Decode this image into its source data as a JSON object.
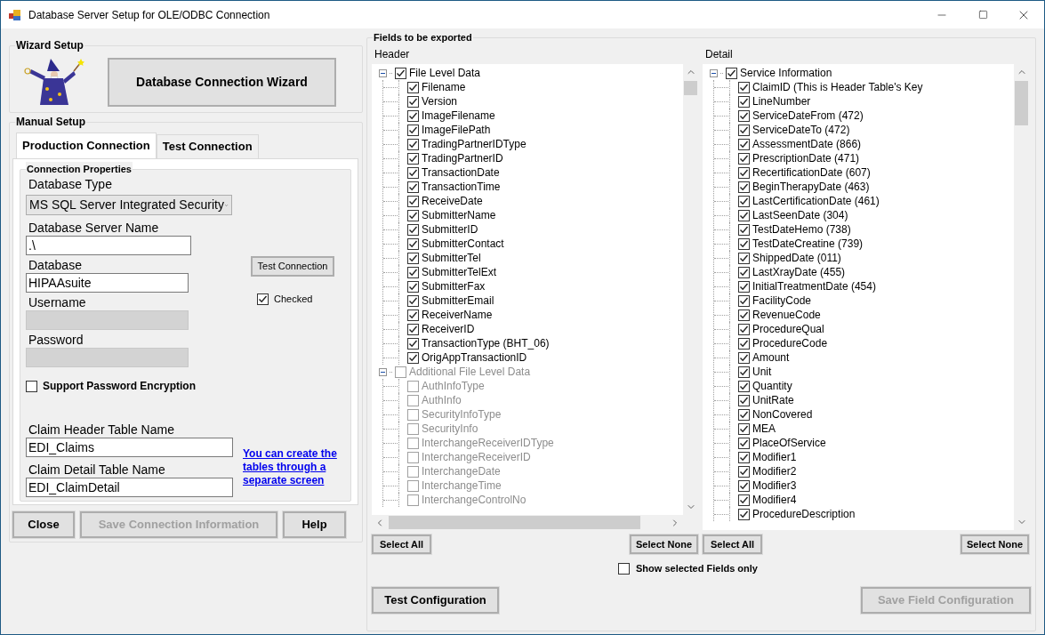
{
  "window": {
    "title": "Database Server Setup for OLE/ODBC Connection"
  },
  "wizard_setup": {
    "title": "Wizard Setup",
    "button": "Database Connection Wizard"
  },
  "manual_setup": {
    "title": "Manual Setup",
    "tabs": [
      {
        "label": "Production Connection",
        "selected": true
      },
      {
        "label": "Test Connection",
        "selected": false
      }
    ],
    "connection_properties": {
      "title": "Connection Properties",
      "database_type": {
        "label": "Database Type",
        "value": "MS SQL Server Integrated Security"
      },
      "server_name": {
        "label": "Database Server Name",
        "value": ".\\"
      },
      "database": {
        "label": "Database",
        "value": "HIPAAsuite"
      },
      "username": {
        "label": "Username",
        "disabled": true
      },
      "password": {
        "label": "Password",
        "disabled": true
      },
      "test_button": "Test Connection",
      "checked_box": {
        "label": "Checked",
        "checked": true
      },
      "encryption": {
        "label": "Support Password Encryption",
        "checked": false
      },
      "header_table": {
        "label": "Claim Header Table Name",
        "value": "EDI_Claims"
      },
      "detail_table": {
        "label": "Claim Detail Table Name",
        "value": "EDI_ClaimDetail"
      },
      "link": "You can create the tables through a separate screen"
    }
  },
  "buttons": [
    {
      "label": "Close",
      "disabled": false
    },
    {
      "label": "Save Connection Information",
      "disabled": true
    },
    {
      "label": "Help",
      "disabled": false
    }
  ],
  "fields": {
    "title": "Fields to be exported",
    "panels": [
      {
        "label": "Header",
        "select_all": "Select All",
        "select_none": "Select None",
        "tree": [
          {
            "label": "File Level Data",
            "checked": true,
            "disabled": false,
            "expanded": true,
            "children": [
              {
                "label": "Filename",
                "checked": true,
                "disabled": false
              },
              {
                "label": "Version",
                "checked": true,
                "disabled": false
              },
              {
                "label": "ImageFilename",
                "checked": true,
                "disabled": false
              },
              {
                "label": "ImageFilePath",
                "checked": true,
                "disabled": false
              },
              {
                "label": "TradingPartnerIDType",
                "checked": true,
                "disabled": false
              },
              {
                "label": "TradingPartnerID",
                "checked": true,
                "disabled": false
              },
              {
                "label": "TransactionDate",
                "checked": true,
                "disabled": false
              },
              {
                "label": "TransactionTime",
                "checked": true,
                "disabled": false
              },
              {
                "label": "ReceiveDate",
                "checked": true,
                "disabled": false
              },
              {
                "label": "SubmitterName",
                "checked": true,
                "disabled": false
              },
              {
                "label": "SubmitterID",
                "checked": true,
                "disabled": false
              },
              {
                "label": "SubmitterContact",
                "checked": true,
                "disabled": false
              },
              {
                "label": "SubmitterTel",
                "checked": true,
                "disabled": false
              },
              {
                "label": "SubmitterTelExt",
                "checked": true,
                "disabled": false
              },
              {
                "label": "SubmitterFax",
                "checked": true,
                "disabled": false
              },
              {
                "label": "SubmitterEmail",
                "checked": true,
                "disabled": false
              },
              {
                "label": "ReceiverName",
                "checked": true,
                "disabled": false
              },
              {
                "label": "ReceiverID",
                "checked": true,
                "disabled": false
              },
              {
                "label": "TransactionType (BHT_06)",
                "checked": true,
                "disabled": false
              },
              {
                "label": "OrigAppTransactionID",
                "checked": true,
                "disabled": false
              }
            ]
          },
          {
            "label": "Additional File Level Data",
            "checked": false,
            "disabled": true,
            "expanded": true,
            "children": [
              {
                "label": "AuthInfoType",
                "checked": false,
                "disabled": true
              },
              {
                "label": "AuthInfo",
                "checked": false,
                "disabled": true
              },
              {
                "label": "SecurityInfoType",
                "checked": false,
                "disabled": true
              },
              {
                "label": "SecurityInfo",
                "checked": false,
                "disabled": true
              },
              {
                "label": "InterchangeReceiverIDType",
                "checked": false,
                "disabled": true
              },
              {
                "label": "InterchangeReceiverID",
                "checked": false,
                "disabled": true
              },
              {
                "label": "InterchangeDate",
                "checked": false,
                "disabled": true
              },
              {
                "label": "InterchangeTime",
                "checked": false,
                "disabled": true
              },
              {
                "label": "InterchangeControlNo",
                "checked": false,
                "disabled": true
              }
            ]
          }
        ]
      },
      {
        "label": "Detail",
        "select_all": "Select All",
        "select_none": "Select None",
        "tree": [
          {
            "label": "Service Information",
            "checked": true,
            "disabled": false,
            "expanded": true,
            "children": [
              {
                "label": "ClaimID (This is Header Table's Key",
                "checked": true,
                "disabled": false
              },
              {
                "label": "LineNumber",
                "checked": true,
                "disabled": false
              },
              {
                "label": "ServiceDateFrom (472)",
                "checked": true,
                "disabled": false
              },
              {
                "label": "ServiceDateTo (472)",
                "checked": true,
                "disabled": false
              },
              {
                "label": "AssessmentDate (866)",
                "checked": true,
                "disabled": false
              },
              {
                "label": "PrescriptionDate (471)",
                "checked": true,
                "disabled": false
              },
              {
                "label": "RecertificationDate (607)",
                "checked": true,
                "disabled": false
              },
              {
                "label": "BeginTherapyDate (463)",
                "checked": true,
                "disabled": false
              },
              {
                "label": "LastCertificationDate (461)",
                "checked": true,
                "disabled": false
              },
              {
                "label": "LastSeenDate (304)",
                "checked": true,
                "disabled": false
              },
              {
                "label": "TestDateHemo (738)",
                "checked": true,
                "disabled": false
              },
              {
                "label": "TestDateCreatine (739)",
                "checked": true,
                "disabled": false
              },
              {
                "label": "ShippedDate (011)",
                "checked": true,
                "disabled": false
              },
              {
                "label": "LastXrayDate (455)",
                "checked": true,
                "disabled": false
              },
              {
                "label": "InitialTreatmentDate (454)",
                "checked": true,
                "disabled": false
              },
              {
                "label": "FacilityCode",
                "checked": true,
                "disabled": false
              },
              {
                "label": "RevenueCode",
                "checked": true,
                "disabled": false
              },
              {
                "label": "ProcedureQual",
                "checked": true,
                "disabled": false
              },
              {
                "label": "ProcedureCode",
                "checked": true,
                "disabled": false
              },
              {
                "label": "Amount",
                "checked": true,
                "disabled": false
              },
              {
                "label": "Unit",
                "checked": true,
                "disabled": false
              },
              {
                "label": "Quantity",
                "checked": true,
                "disabled": false
              },
              {
                "label": "UnitRate",
                "checked": true,
                "disabled": false
              },
              {
                "label": "NonCovered",
                "checked": true,
                "disabled": false
              },
              {
                "label": "MEA",
                "checked": true,
                "disabled": false
              },
              {
                "label": "PlaceOfService",
                "checked": true,
                "disabled": false
              },
              {
                "label": "Modifier1",
                "checked": true,
                "disabled": false
              },
              {
                "label": "Modifier2",
                "checked": true,
                "disabled": false
              },
              {
                "label": "Modifier3",
                "checked": true,
                "disabled": false
              },
              {
                "label": "Modifier4",
                "checked": true,
                "disabled": false
              },
              {
                "label": "ProcedureDescription",
                "checked": true,
                "disabled": false
              }
            ]
          }
        ]
      }
    ],
    "show_selected": {
      "label": "Show selected Fields only",
      "checked": false
    },
    "test_button": {
      "label": "Test Configuration",
      "disabled": false
    },
    "save_button": {
      "label": "Save Field Configuration",
      "disabled": true
    }
  }
}
